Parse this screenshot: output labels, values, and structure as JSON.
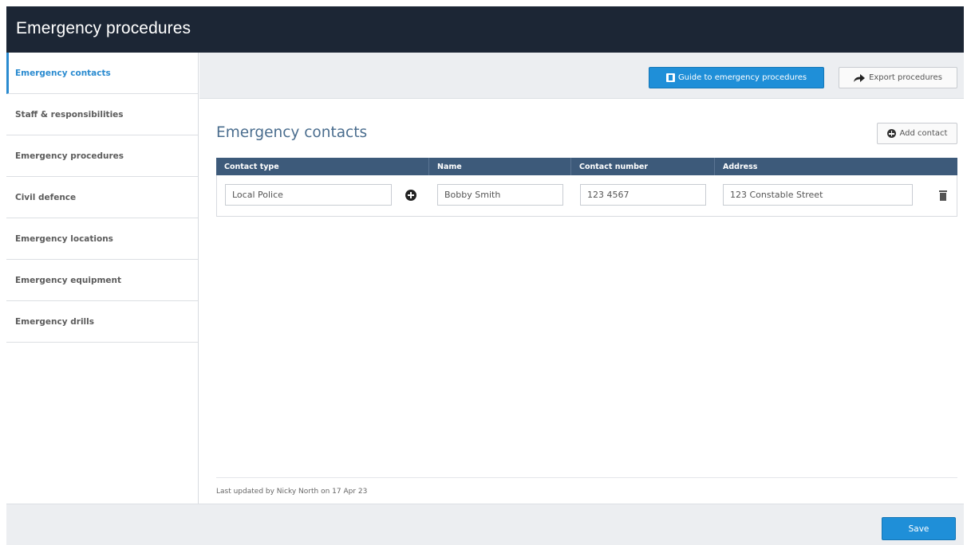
{
  "header": {
    "title": "Emergency procedures"
  },
  "sidebar": {
    "items": [
      {
        "label": "Emergency contacts",
        "active": true
      },
      {
        "label": "Staff & responsibilities"
      },
      {
        "label": "Emergency procedures"
      },
      {
        "label": "Civil defence"
      },
      {
        "label": "Emergency locations"
      },
      {
        "label": "Emergency equipment"
      },
      {
        "label": "Emergency drills"
      }
    ]
  },
  "toolbar": {
    "guide_label": "Guide to emergency procedures",
    "export_label": "Export procedures"
  },
  "main": {
    "section_title": "Emergency contacts",
    "add_label": "Add contact",
    "table": {
      "columns": [
        "Contact type",
        "Name",
        "Contact number",
        "Address"
      ],
      "rows": [
        {
          "contact_type": "Local Police",
          "name": "Bobby Smith",
          "contact_number": "123 4567",
          "address": "123 Constable Street"
        }
      ]
    },
    "last_updated": "Last updated by Nicky North on 17 Apr 23"
  },
  "footer": {
    "save_label": "Save"
  },
  "colors": {
    "accent": "#1f8fd8",
    "header_bg": "#1c2635",
    "table_header": "#3d5a7a"
  },
  "icons": {
    "guide": "book-icon",
    "export": "share-arrow-icon",
    "add": "plus-circle-icon",
    "delete": "trash-icon"
  }
}
